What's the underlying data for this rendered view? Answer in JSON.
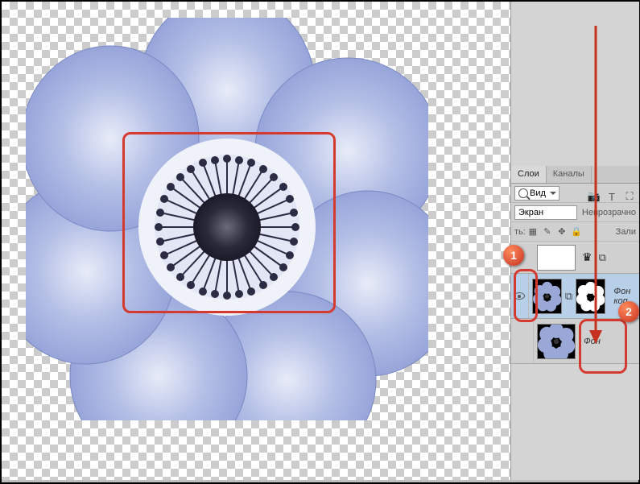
{
  "tabs": {
    "layers": "Слои",
    "channels": "Каналы"
  },
  "filter": {
    "mode": "Вид"
  },
  "blend": {
    "mode": "Экран"
  },
  "opacity_label": "Непрозрачно",
  "lock": {
    "label": "ть:"
  },
  "fill_label": "Зали",
  "layers": {
    "copy_name": "Фон коп",
    "bg_name": "Фон"
  },
  "badges": {
    "one": "1",
    "two": "2"
  },
  "tool_icons": {
    "camera": "📷",
    "text": "T",
    "crop": "⛶"
  }
}
